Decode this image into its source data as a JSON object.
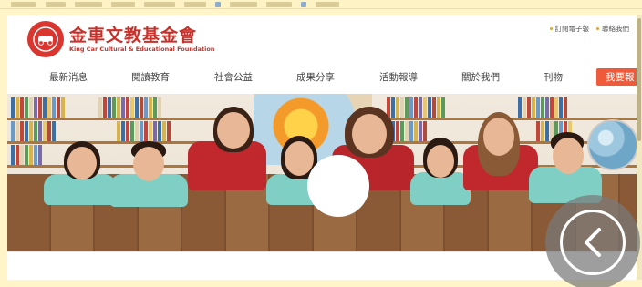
{
  "logo": {
    "name": "金車文教基金會",
    "english": "King Car Cultural & Educational Foundation"
  },
  "top_links": [
    {
      "label": "訂閱電子報",
      "icon": "dot"
    },
    {
      "label": "聯絡我們",
      "icon": "dot"
    }
  ],
  "nav": {
    "items": [
      "最新消息",
      "閱讀教育",
      "社會公益",
      "成果分享",
      "活動報導",
      "關於我們",
      "刊物"
    ],
    "join_label": "我要報"
  },
  "hero": {
    "description_icon": "photo-of-children-and-teachers-lying-on-floor"
  },
  "colors": {
    "brand_red": "#c9302a",
    "join_button": "#ef5a3a",
    "page_background": "#fff5c8"
  },
  "overlay_icons": {
    "back": "chevron-left-icon",
    "center": "white-circle"
  }
}
